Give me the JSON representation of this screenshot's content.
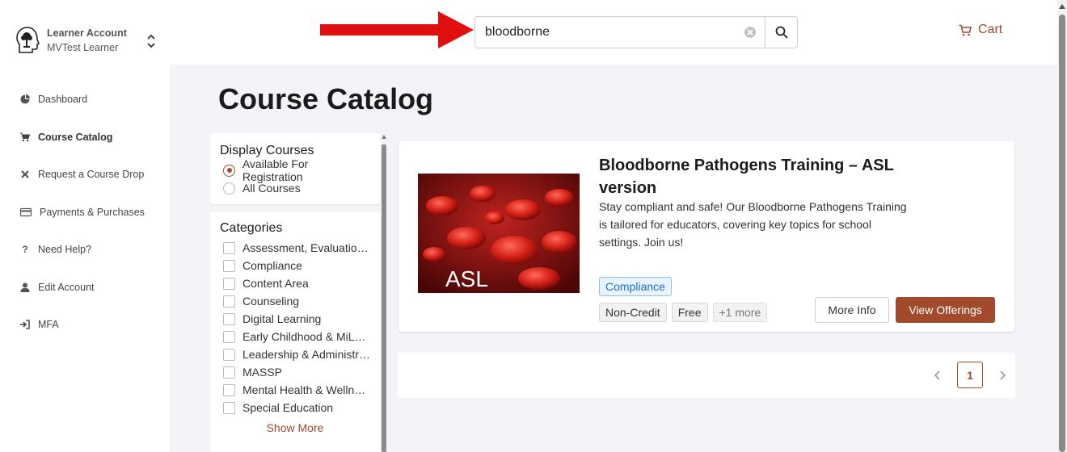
{
  "account": {
    "name": "Learner Account",
    "user": "MVTest Learner"
  },
  "sidebar": {
    "items": [
      {
        "label": "Dashboard",
        "icon": "pie-chart-icon"
      },
      {
        "label": "Course Catalog",
        "icon": "cart-icon"
      },
      {
        "label": "Request a Course Drop",
        "icon": "x-icon"
      },
      {
        "label": "Payments & Purchases",
        "icon": "credit-card-icon"
      },
      {
        "label": "Need Help?",
        "icon": "question-icon"
      },
      {
        "label": "Edit Account",
        "icon": "user-icon"
      },
      {
        "label": "MFA",
        "icon": "sign-in-icon"
      }
    ],
    "active_index": 1
  },
  "search": {
    "value": "bloodborne"
  },
  "header": {
    "cart_label": "Cart"
  },
  "main": {
    "title": "Course Catalog"
  },
  "filters": {
    "display": {
      "title": "Display Courses",
      "options": [
        "Available For Registration",
        "All Courses"
      ],
      "selected": 0
    },
    "categories": {
      "title": "Categories",
      "items": [
        "Assessment, Evaluation & Accountability",
        "Compliance",
        "Content Area",
        "Counseling",
        "Digital Learning",
        "Early Childhood & MiLEAP",
        "Leadership & Administration",
        "MASSP",
        "Mental Health & Wellness",
        "Special Education"
      ],
      "show_more": "Show More"
    }
  },
  "course": {
    "image_text": "ASL",
    "title": "Bloodborne Pathogens Training – ASL version",
    "description": "Stay compliant and safe! Our Bloodborne Pathogens Training is tailored for educators, covering key topics for school settings. Join us!",
    "category_tag": "Compliance",
    "tags": [
      "Non-Credit",
      "Free"
    ],
    "more_tags": "+1 more",
    "more_info_label": "More Info",
    "view_offerings_label": "View Offerings"
  },
  "pagination": {
    "current": "1"
  },
  "colors": {
    "accent": "#a14a2c",
    "arrow": "#e01010",
    "main_bg": "#f2f4f7",
    "tag_blue": "#1a6fc4"
  }
}
